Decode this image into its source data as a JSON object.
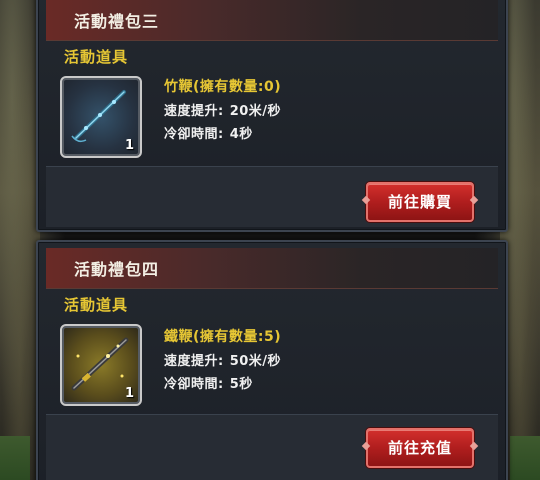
{
  "packs": [
    {
      "title": "活動禮包三",
      "category": "活動道具",
      "item": {
        "name": "竹鞭(擁有數量:0)",
        "quantity": "1",
        "icon": "bamboo-whip-icon",
        "speed_label": "速度提升:",
        "speed_value": "20米/秒",
        "cooldown_label": "冷卻時間:",
        "cooldown_value": "4秒"
      },
      "button_label": "前往購買"
    },
    {
      "title": "活動禮包四",
      "category": "活動道具",
      "item": {
        "name": "鐵鞭(擁有數量:5)",
        "quantity": "1",
        "icon": "iron-whip-icon",
        "speed_label": "速度提升:",
        "speed_value": "50米/秒",
        "cooldown_label": "冷卻時間:",
        "cooldown_value": "5秒"
      },
      "button_label": "前往充值"
    }
  ],
  "colors": {
    "title_accent": "#6a2a26",
    "label_yellow": "#e6c634",
    "button_red": "#c0241f"
  }
}
